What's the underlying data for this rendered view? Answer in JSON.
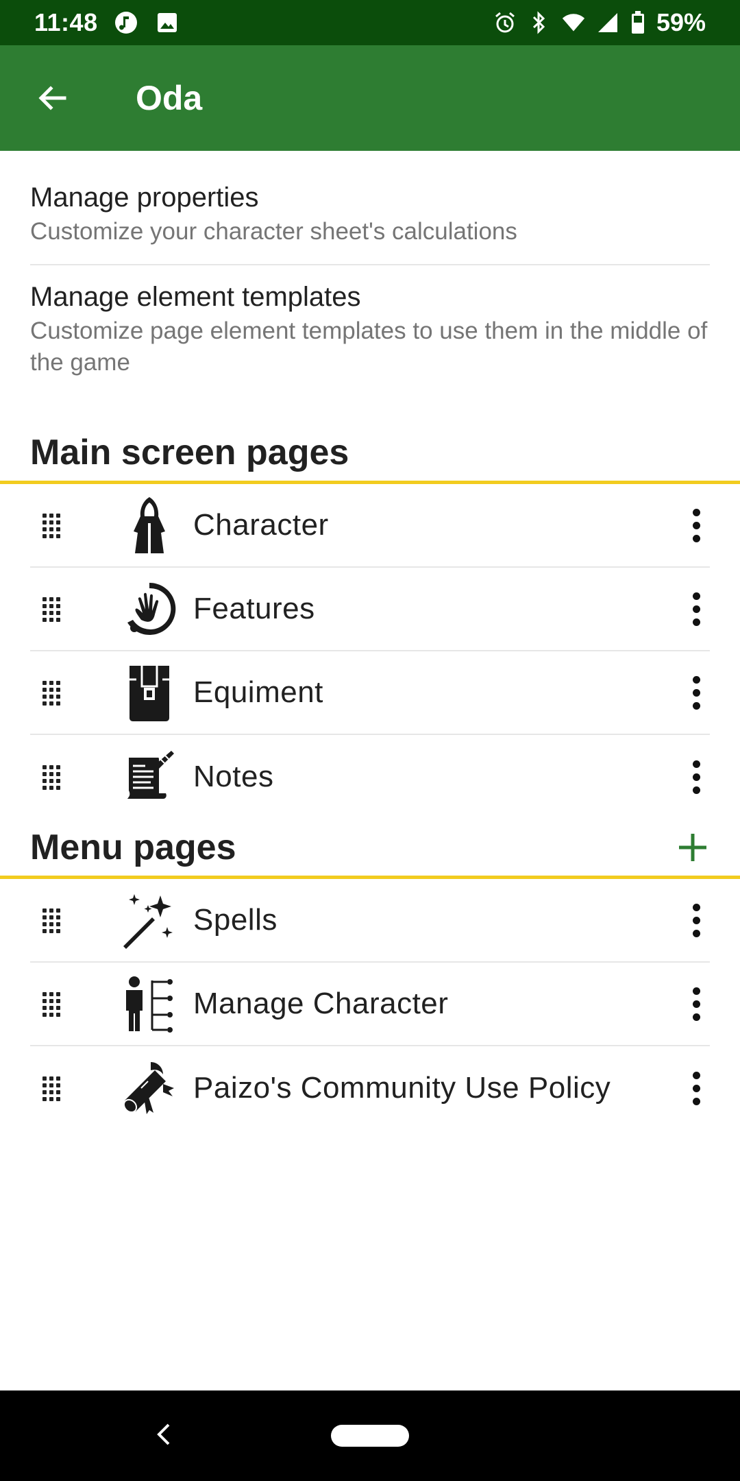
{
  "status_bar": {
    "time": "11:48",
    "battery": "59%"
  },
  "app_bar": {
    "title": "Oda"
  },
  "settings": [
    {
      "title": "Manage properties",
      "subtitle": "Customize your character sheet's calculations"
    },
    {
      "title": "Manage element templates",
      "subtitle": "Customize page element templates to use them in the middle of the game"
    }
  ],
  "main_section": {
    "title": "Main screen pages",
    "items": [
      {
        "label": "Character",
        "icon": "hooded-figure-icon"
      },
      {
        "label": "Features",
        "icon": "hand-circle-icon"
      },
      {
        "label": "Equiment",
        "icon": "backpack-icon"
      },
      {
        "label": "Notes",
        "icon": "scroll-quill-icon"
      }
    ]
  },
  "menu_section": {
    "title": "Menu pages",
    "items": [
      {
        "label": "Spells",
        "icon": "magic-wand-icon"
      },
      {
        "label": "Manage Character",
        "icon": "person-tree-icon"
      },
      {
        "label": "Paizo's Community Use Policy",
        "icon": "diploma-scroll-icon"
      }
    ]
  },
  "colors": {
    "status_bar": "#0b4d0b",
    "app_bar": "#2e7d32",
    "section_divider": "#f2cc1f",
    "accent": "#2e7d32"
  }
}
